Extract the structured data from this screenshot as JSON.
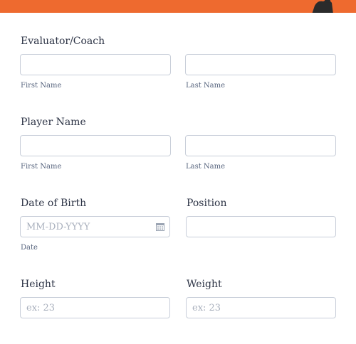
{
  "form": {
    "evaluator": {
      "label": "Evaluator/Coach",
      "first_sublabel": "First Name",
      "last_sublabel": "Last Name",
      "first_value": "",
      "last_value": ""
    },
    "player": {
      "label": "Player Name",
      "first_sublabel": "First Name",
      "last_sublabel": "Last Name",
      "first_value": "",
      "last_value": ""
    },
    "dob": {
      "label": "Date of Birth",
      "placeholder": "MM-DD-YYYY",
      "sublabel": "Date",
      "icon": "calendar-icon"
    },
    "position": {
      "label": "Position",
      "value": ""
    },
    "height": {
      "label": "Height",
      "placeholder": "ex: 23"
    },
    "weight": {
      "label": "Weight",
      "placeholder": "ex: 23"
    }
  },
  "colors": {
    "banner": "#ee6a2f",
    "border": "#c8ced9",
    "text": "#2c3345",
    "placeholder": "#a9b0bd"
  }
}
